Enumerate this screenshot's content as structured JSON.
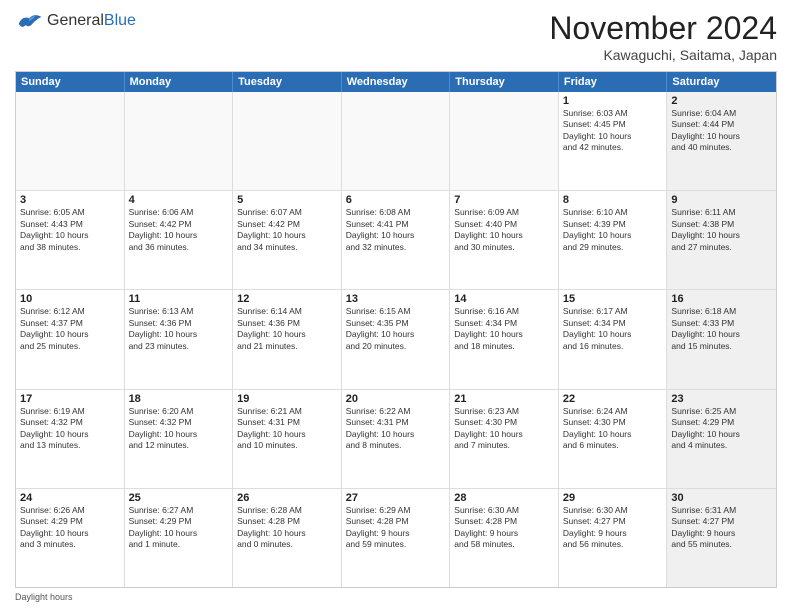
{
  "logo": {
    "general": "General",
    "blue": "Blue"
  },
  "title": "November 2024",
  "location": "Kawaguchi, Saitama, Japan",
  "headers": [
    "Sunday",
    "Monday",
    "Tuesday",
    "Wednesday",
    "Thursday",
    "Friday",
    "Saturday"
  ],
  "rows": [
    [
      {
        "day": "",
        "info": "",
        "empty": true
      },
      {
        "day": "",
        "info": "",
        "empty": true
      },
      {
        "day": "",
        "info": "",
        "empty": true
      },
      {
        "day": "",
        "info": "",
        "empty": true
      },
      {
        "day": "",
        "info": "",
        "empty": true
      },
      {
        "day": "1",
        "info": "Sunrise: 6:03 AM\nSunset: 4:45 PM\nDaylight: 10 hours\nand 42 minutes.",
        "empty": false
      },
      {
        "day": "2",
        "info": "Sunrise: 6:04 AM\nSunset: 4:44 PM\nDaylight: 10 hours\nand 40 minutes.",
        "empty": false,
        "shaded": true
      }
    ],
    [
      {
        "day": "3",
        "info": "Sunrise: 6:05 AM\nSunset: 4:43 PM\nDaylight: 10 hours\nand 38 minutes.",
        "empty": false
      },
      {
        "day": "4",
        "info": "Sunrise: 6:06 AM\nSunset: 4:42 PM\nDaylight: 10 hours\nand 36 minutes.",
        "empty": false
      },
      {
        "day": "5",
        "info": "Sunrise: 6:07 AM\nSunset: 4:42 PM\nDaylight: 10 hours\nand 34 minutes.",
        "empty": false
      },
      {
        "day": "6",
        "info": "Sunrise: 6:08 AM\nSunset: 4:41 PM\nDaylight: 10 hours\nand 32 minutes.",
        "empty": false
      },
      {
        "day": "7",
        "info": "Sunrise: 6:09 AM\nSunset: 4:40 PM\nDaylight: 10 hours\nand 30 minutes.",
        "empty": false
      },
      {
        "day": "8",
        "info": "Sunrise: 6:10 AM\nSunset: 4:39 PM\nDaylight: 10 hours\nand 29 minutes.",
        "empty": false
      },
      {
        "day": "9",
        "info": "Sunrise: 6:11 AM\nSunset: 4:38 PM\nDaylight: 10 hours\nand 27 minutes.",
        "empty": false,
        "shaded": true
      }
    ],
    [
      {
        "day": "10",
        "info": "Sunrise: 6:12 AM\nSunset: 4:37 PM\nDaylight: 10 hours\nand 25 minutes.",
        "empty": false
      },
      {
        "day": "11",
        "info": "Sunrise: 6:13 AM\nSunset: 4:36 PM\nDaylight: 10 hours\nand 23 minutes.",
        "empty": false
      },
      {
        "day": "12",
        "info": "Sunrise: 6:14 AM\nSunset: 4:36 PM\nDaylight: 10 hours\nand 21 minutes.",
        "empty": false
      },
      {
        "day": "13",
        "info": "Sunrise: 6:15 AM\nSunset: 4:35 PM\nDaylight: 10 hours\nand 20 minutes.",
        "empty": false
      },
      {
        "day": "14",
        "info": "Sunrise: 6:16 AM\nSunset: 4:34 PM\nDaylight: 10 hours\nand 18 minutes.",
        "empty": false
      },
      {
        "day": "15",
        "info": "Sunrise: 6:17 AM\nSunset: 4:34 PM\nDaylight: 10 hours\nand 16 minutes.",
        "empty": false
      },
      {
        "day": "16",
        "info": "Sunrise: 6:18 AM\nSunset: 4:33 PM\nDaylight: 10 hours\nand 15 minutes.",
        "empty": false,
        "shaded": true
      }
    ],
    [
      {
        "day": "17",
        "info": "Sunrise: 6:19 AM\nSunset: 4:32 PM\nDaylight: 10 hours\nand 13 minutes.",
        "empty": false
      },
      {
        "day": "18",
        "info": "Sunrise: 6:20 AM\nSunset: 4:32 PM\nDaylight: 10 hours\nand 12 minutes.",
        "empty": false
      },
      {
        "day": "19",
        "info": "Sunrise: 6:21 AM\nSunset: 4:31 PM\nDaylight: 10 hours\nand 10 minutes.",
        "empty": false
      },
      {
        "day": "20",
        "info": "Sunrise: 6:22 AM\nSunset: 4:31 PM\nDaylight: 10 hours\nand 8 minutes.",
        "empty": false
      },
      {
        "day": "21",
        "info": "Sunrise: 6:23 AM\nSunset: 4:30 PM\nDaylight: 10 hours\nand 7 minutes.",
        "empty": false
      },
      {
        "day": "22",
        "info": "Sunrise: 6:24 AM\nSunset: 4:30 PM\nDaylight: 10 hours\nand 6 minutes.",
        "empty": false
      },
      {
        "day": "23",
        "info": "Sunrise: 6:25 AM\nSunset: 4:29 PM\nDaylight: 10 hours\nand 4 minutes.",
        "empty": false,
        "shaded": true
      }
    ],
    [
      {
        "day": "24",
        "info": "Sunrise: 6:26 AM\nSunset: 4:29 PM\nDaylight: 10 hours\nand 3 minutes.",
        "empty": false
      },
      {
        "day": "25",
        "info": "Sunrise: 6:27 AM\nSunset: 4:29 PM\nDaylight: 10 hours\nand 1 minute.",
        "empty": false
      },
      {
        "day": "26",
        "info": "Sunrise: 6:28 AM\nSunset: 4:28 PM\nDaylight: 10 hours\nand 0 minutes.",
        "empty": false
      },
      {
        "day": "27",
        "info": "Sunrise: 6:29 AM\nSunset: 4:28 PM\nDaylight: 9 hours\nand 59 minutes.",
        "empty": false
      },
      {
        "day": "28",
        "info": "Sunrise: 6:30 AM\nSunset: 4:28 PM\nDaylight: 9 hours\nand 58 minutes.",
        "empty": false
      },
      {
        "day": "29",
        "info": "Sunrise: 6:30 AM\nSunset: 4:27 PM\nDaylight: 9 hours\nand 56 minutes.",
        "empty": false
      },
      {
        "day": "30",
        "info": "Sunrise: 6:31 AM\nSunset: 4:27 PM\nDaylight: 9 hours\nand 55 minutes.",
        "empty": false,
        "shaded": true
      }
    ]
  ],
  "footer": "Daylight hours"
}
